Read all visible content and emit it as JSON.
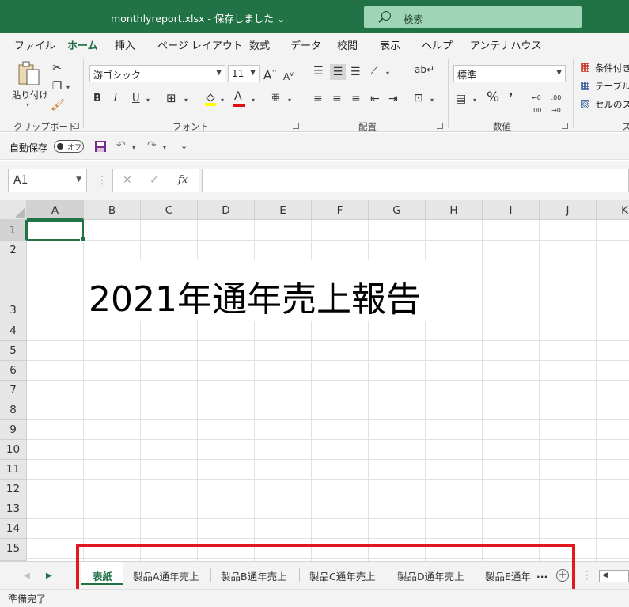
{
  "titlebar": {
    "filename": "monthlyreport.xlsx",
    "separator": "-",
    "save_state": "保存しました",
    "caret": "⌄",
    "search_label": "検索"
  },
  "menu": {
    "tabs": [
      "ファイル",
      "ホーム",
      "挿入",
      "ページ レイアウト",
      "数式",
      "データ",
      "校閲",
      "表示",
      "ヘルプ",
      "アンテナハウス"
    ],
    "active": "ホーム"
  },
  "ribbon": {
    "clipboard": {
      "paste_label": "貼り付け",
      "group_label": "クリップボード"
    },
    "font": {
      "font_name": "游ゴシック",
      "font_size": "11",
      "bold": "B",
      "italic": "I",
      "underline": "U",
      "grow": "A",
      "shrink": "A",
      "font_color_letter": "A",
      "phonetic": "亜",
      "group_label": "フォント"
    },
    "alignment": {
      "group_label": "配置"
    },
    "number": {
      "format": "標準",
      "percent": "%",
      "comma": "❜",
      "inc_decimal": ".00",
      "dec_decimal": ".00",
      "group_label": "数値"
    },
    "styles": {
      "conditional": "条件付き",
      "table": "テーブルと",
      "cell_styles": "セルのスタ",
      "group_label": "ス"
    }
  },
  "quickaccess": {
    "autosave_label": "自動保存",
    "autosave_toggle": "オフ"
  },
  "formulabar": {
    "namebox": "A1",
    "cancel": "✕",
    "enter": "✓",
    "fx": "fx",
    "value": ""
  },
  "grid": {
    "columns": [
      "A",
      "B",
      "C",
      "D",
      "E",
      "F",
      "G",
      "H",
      "I",
      "J",
      "K"
    ],
    "rows": [
      "1",
      "2",
      "3",
      "4",
      "5",
      "6",
      "7",
      "8",
      "9",
      "10",
      "11",
      "12",
      "13",
      "14",
      "15"
    ],
    "cells": {
      "B3": "2021年通年売上報告"
    },
    "active_cell": "A1"
  },
  "sheets": {
    "tabs": [
      "表紙",
      "製品A通年売上",
      "製品B通年売上",
      "製品C通年売上",
      "製品D通年売上",
      "製品E通年"
    ],
    "active": "表紙",
    "more": "...",
    "add": "+"
  },
  "status": {
    "text": "準備完了"
  },
  "highlight_color": "#e0181f",
  "accent_color": "#217346"
}
